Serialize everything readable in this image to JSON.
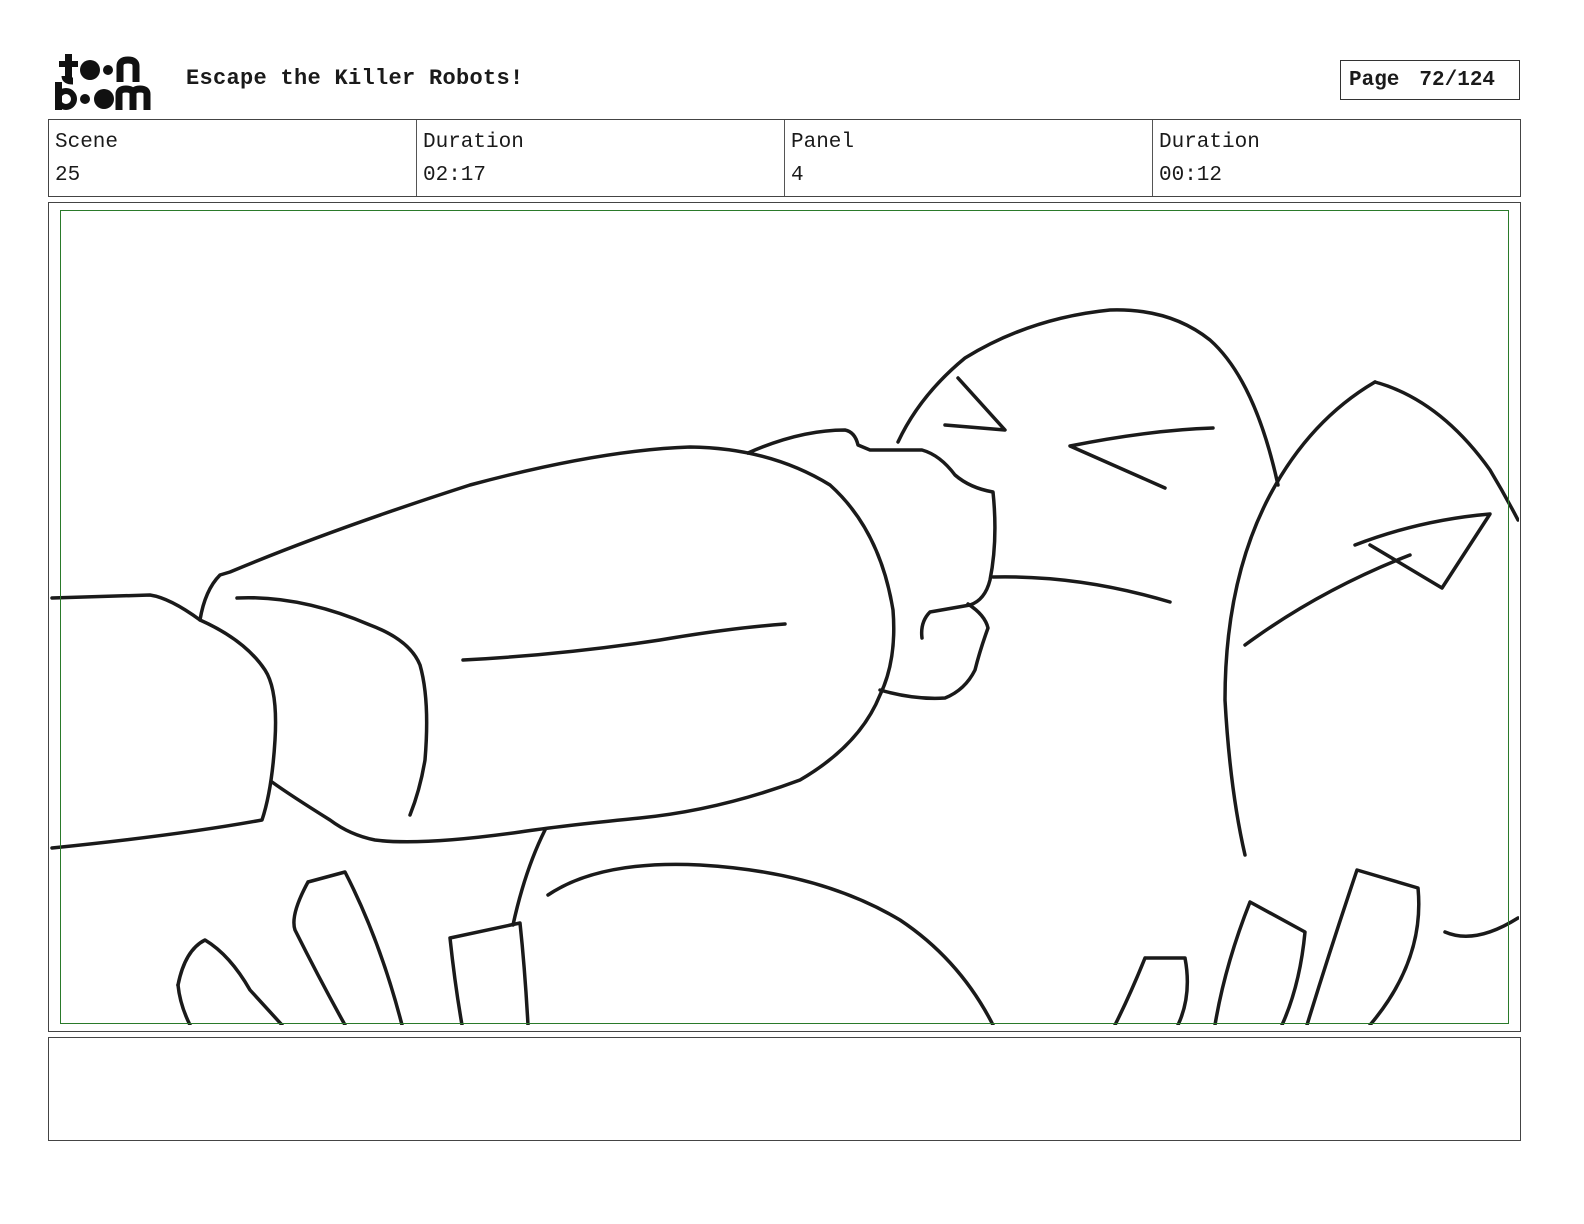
{
  "header": {
    "logo_alt": "toon boom",
    "title": "Escape the Killer Robots!",
    "page_label": "Page",
    "page_value": "72/124"
  },
  "info": {
    "scene_label": "Scene",
    "scene_value": "25",
    "scene_duration_label": "Duration",
    "scene_duration_value": "02:17",
    "panel_label": "Panel",
    "panel_value": "4",
    "panel_duration_label": "Duration",
    "panel_duration_value": "00:12"
  },
  "notes": {
    "text": ""
  }
}
